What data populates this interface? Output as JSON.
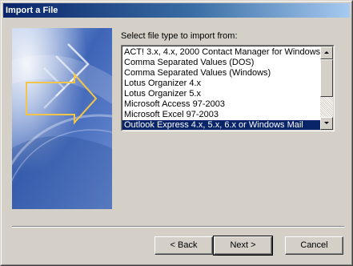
{
  "window": {
    "title": "Import a File"
  },
  "main": {
    "prompt": "Select file type to import from:",
    "file_types": [
      "ACT! 3.x, 4.x, 2000 Contact Manager for Windows",
      "Comma Separated Values (DOS)",
      "Comma Separated Values (Windows)",
      "Lotus Organizer 4.x",
      "Lotus Organizer 5.x",
      "Microsoft Access 97-2003",
      "Microsoft Excel 97-2003",
      "Outlook Express 4.x, 5.x, 6.x or Windows Mail"
    ],
    "selected_file_type": "Outlook Express 4.x, 5.x, 6.x or Windows Mail"
  },
  "buttons": {
    "back": "< Back",
    "next": "Next >",
    "cancel": "Cancel"
  },
  "colors": {
    "title_bar_start": "#0a246a",
    "title_bar_end": "#a6caf0",
    "selection": "#0a246a",
    "dialog_face": "#d4d0c8"
  }
}
